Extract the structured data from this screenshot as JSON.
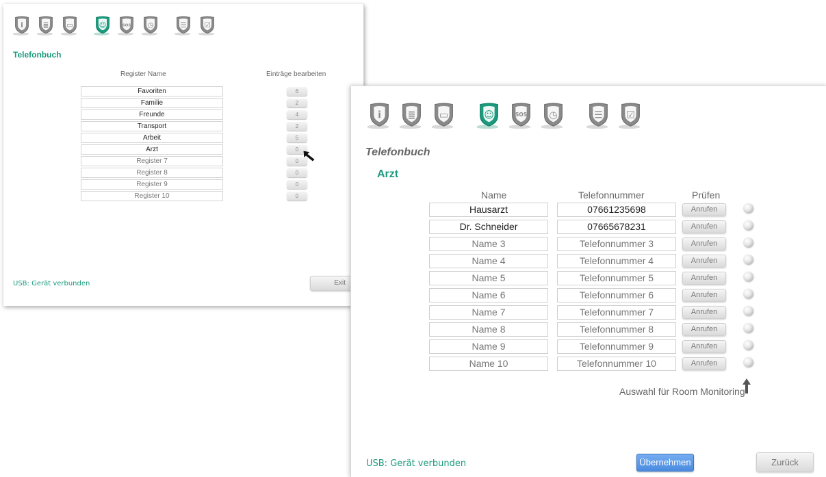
{
  "colors": {
    "teal": "#1b9a7d",
    "blue": "#5a9ae8",
    "icon_grey": "#8a8a8a"
  },
  "nav_icons": [
    "info-icon",
    "contacts-list-icon",
    "intercom-icon",
    "phonebook-icon",
    "sos-icon",
    "alarm-clock-icon",
    "settings-sliders-icon",
    "display-check-icon"
  ],
  "nav_icon_glyphs": [
    "i",
    "≣",
    "▭",
    "☺",
    "SOS",
    "◷",
    "☰",
    "☑"
  ],
  "back_window": {
    "title": "Telefonbuch",
    "col_register": "Register Name",
    "col_entries": "Einträge bearbeiten",
    "registers": [
      {
        "name": "Favoriten",
        "count": "6",
        "custom": true
      },
      {
        "name": "Familie",
        "count": "2",
        "custom": true
      },
      {
        "name": "Freunde",
        "count": "4",
        "custom": true
      },
      {
        "name": "Transport",
        "count": "2",
        "custom": true
      },
      {
        "name": "Arbeit",
        "count": "5",
        "custom": true
      },
      {
        "name": "Arzt",
        "count": "0",
        "custom": true
      },
      {
        "name": "Register 7",
        "count": "0",
        "custom": false
      },
      {
        "name": "Register 8",
        "count": "0",
        "custom": false
      },
      {
        "name": "Register 9",
        "count": "0",
        "custom": false
      },
      {
        "name": "Register 10",
        "count": "0",
        "custom": false
      }
    ],
    "usb_status": "USB: Gerät verbunden",
    "exit_label": "Exit"
  },
  "front_window": {
    "title": "Telefonbuch",
    "subtitle": "Arzt",
    "col_name": "Name",
    "col_phone": "Telefonnummer",
    "col_check": "Prüfen",
    "entries": [
      {
        "name": "Hausarzt",
        "phone": "07661235698",
        "filled": true
      },
      {
        "name": "Dr. Schneider",
        "phone": "07665678231",
        "filled": true
      },
      {
        "name": "Name 3",
        "phone": "Telefonnummer 3",
        "filled": false
      },
      {
        "name": "Name 4",
        "phone": "Telefonnummer 4",
        "filled": false
      },
      {
        "name": "Name 5",
        "phone": "Telefonnummer 5",
        "filled": false
      },
      {
        "name": "Name 6",
        "phone": "Telefonnummer 6",
        "filled": false
      },
      {
        "name": "Name 7",
        "phone": "Telefonnummer 7",
        "filled": false
      },
      {
        "name": "Name 8",
        "phone": "Telefonnummer 8",
        "filled": false
      },
      {
        "name": "Name 9",
        "phone": "Telefonnummer 9",
        "filled": false
      },
      {
        "name": "Name 10",
        "phone": "Telefonnummer 10",
        "filled": false
      }
    ],
    "call_label": "Anrufen",
    "room_monitoring_label": "Auswahl für Room Monitoring",
    "usb_status": "USB: Gerät verbunden",
    "apply_label": "Übernehmen",
    "back_label": "Zurück"
  }
}
